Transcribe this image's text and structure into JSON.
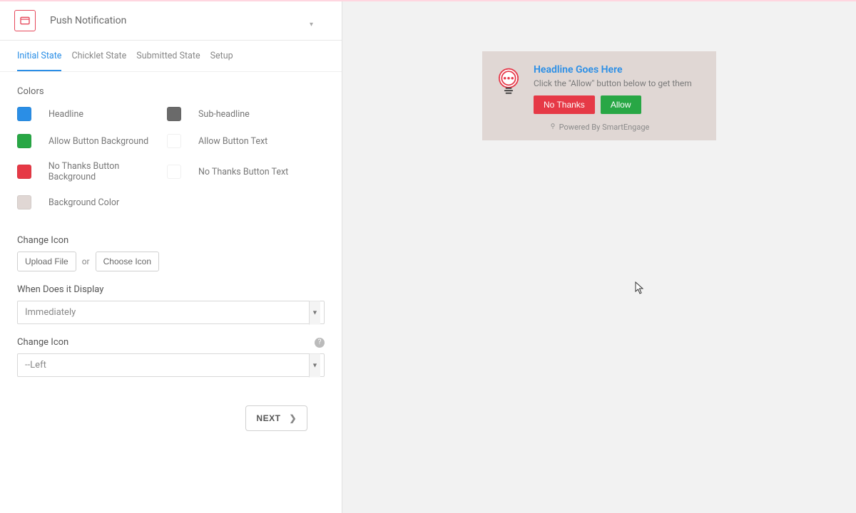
{
  "header": {
    "title": "Push Notification"
  },
  "tabs": [
    {
      "label": "Initial State",
      "active": true
    },
    {
      "label": "Chicklet State",
      "active": false
    },
    {
      "label": "Submitted State",
      "active": false
    },
    {
      "label": "Setup",
      "active": false
    }
  ],
  "colors_section": {
    "title": "Colors",
    "items": [
      {
        "label": "Headline",
        "hex": "#2a8ee6"
      },
      {
        "label": "Sub-headline",
        "hex": "#6a6a6a"
      },
      {
        "label": "Allow Button Background",
        "hex": "#28a745"
      },
      {
        "label": "Allow Button Text",
        "hex": "#ffffff"
      },
      {
        "label": "No Thanks Button Background",
        "hex": "#e63946"
      },
      {
        "label": "No Thanks Button Text",
        "hex": "#ffffff"
      },
      {
        "label": "Background Color",
        "hex": "#e0d7d4"
      }
    ]
  },
  "change_icon": {
    "label": "Change Icon",
    "upload": "Upload File",
    "or": "or",
    "choose": "Choose Icon"
  },
  "display_when": {
    "label": "When Does it Display",
    "value": "Immediately"
  },
  "position": {
    "label": "Change Icon",
    "value": "--Left"
  },
  "next_button": "NEXT",
  "preview": {
    "headline": "Headline Goes Here",
    "subheadline": "Click the \"Allow\" button below to get them",
    "no_thanks": "No Thanks",
    "allow": "Allow",
    "powered": "Powered By SmartEngage",
    "colors": {
      "headline": "#2a8ee6",
      "sub": "#7a7a7a",
      "no_bg": "#e63946",
      "allow_bg": "#28a745",
      "bg": "#e0d7d4"
    }
  }
}
